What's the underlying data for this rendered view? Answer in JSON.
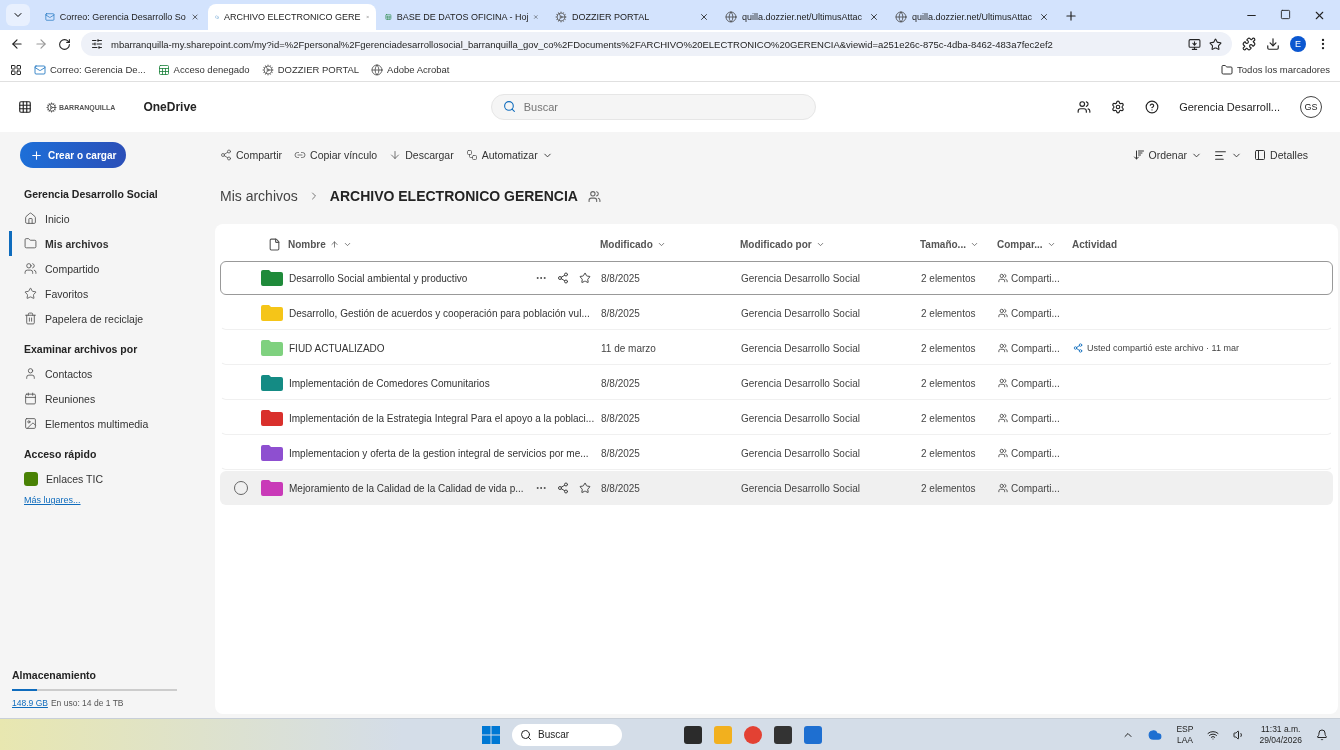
{
  "browser": {
    "tabs": [
      {
        "title": "Correo: Gerencia Desarrollo So",
        "selected": false
      },
      {
        "title": "ARCHIVO ELECTRONICO GERE",
        "selected": true
      },
      {
        "title": "BASE DE DATOS OFICINA - Hoj",
        "selected": false
      },
      {
        "title": "DOZZIER PORTAL",
        "selected": false
      },
      {
        "title": "quilla.dozzier.net/UltimusAttac",
        "selected": false
      },
      {
        "title": "quilla.dozzier.net/UltimusAttac",
        "selected": false
      }
    ],
    "address": "mbarranquilla-my.sharepoint.com/my?id=%2Fpersonal%2Fgerenciadesarrollosocial_barranquilla_gov_co%2FDocuments%2FARCHIVO%20ELECTRONICO%20GERENCIA&viewid=a251e26c-875c-4dba-8462-483a7fec2ef2",
    "profile": "E",
    "bookmarks": [
      "Correo: Gerencia De...",
      "Acceso denegado",
      "DOZZIER PORTAL",
      "Adobe Acrobat"
    ],
    "all_bookmarks": "Todos los marcadores"
  },
  "header": {
    "logo": "BARRANQUILLA",
    "app": "OneDrive",
    "search_placeholder": "Buscar",
    "user": "Gerencia Desarroll...",
    "initials": "GS"
  },
  "sidebar": {
    "create_button": "Crear o cargar",
    "account": "Gerencia Desarrollo Social",
    "items": [
      {
        "label": "Inicio",
        "selected": false
      },
      {
        "label": "Mis archivos",
        "selected": true
      },
      {
        "label": "Compartido",
        "selected": false
      },
      {
        "label": "Favoritos",
        "selected": false
      },
      {
        "label": "Papelera de reciclaje",
        "selected": false
      }
    ],
    "browse_heading": "Examinar archivos por",
    "browse_items": [
      "Contactos",
      "Reuniones",
      "Elementos multimedia"
    ],
    "quick_heading": "Acceso rápido",
    "quick_items": [
      {
        "label": "Enlaces TIC",
        "color": "#498205"
      }
    ],
    "more_link": "Más lugares...",
    "storage": {
      "heading": "Almacenamiento",
      "used_link": "148.9 GB",
      "text": "En uso: 14 de 1 TB",
      "level": 0.15
    }
  },
  "toolbar": {
    "actions": [
      "Compartir",
      "Copiar vínculo",
      "Descargar",
      "Automatizar"
    ],
    "sort": "Ordenar",
    "details": "Detalles"
  },
  "breadcrumb": {
    "parent": "Mis archivos",
    "current": "ARCHIVO ELECTRONICO GERENCIA"
  },
  "table": {
    "columns": [
      "Nombre",
      "Modificado",
      "Modificado por",
      "Tamaño...",
      "Compar...",
      "Actividad"
    ],
    "rows": [
      {
        "name": "Desarrollo Social ambiental y productivo",
        "modified": "8/8/2025",
        "by": "Gerencia Desarrollo Social",
        "size": "2 elementos",
        "sharing": "Comparti...",
        "color": "#1f8a3a",
        "focused": true,
        "hovered": false
      },
      {
        "name": "Desarrollo, Gestión de acuerdos y cooperación para población vul...",
        "modified": "8/8/2025",
        "by": "Gerencia Desarrollo Social",
        "size": "2 elementos",
        "sharing": "Comparti...",
        "color": "#f5c518",
        "focused": false,
        "hovered": false
      },
      {
        "name": "FIUD ACTUALIZADO",
        "modified": "11 de marzo",
        "by": "Gerencia Desarrollo Social",
        "size": "2 elementos",
        "sharing": "Comparti...",
        "activity": "Usted compartió este archivo · 11 mar",
        "color": "#7fd17f",
        "focused": false,
        "hovered": false
      },
      {
        "name": "Implementación de Comedores Comunitarios",
        "modified": "8/8/2025",
        "by": "Gerencia Desarrollo Social",
        "size": "2 elementos",
        "sharing": "Comparti...",
        "color": "#148b84",
        "focused": false,
        "hovered": false
      },
      {
        "name": "Implementación de la Estrategia Integral Para el apoyo a la poblaci...",
        "modified": "8/8/2025",
        "by": "Gerencia Desarrollo Social",
        "size": "2 elementos",
        "sharing": "Comparti...",
        "color": "#d9302c",
        "focused": false,
        "hovered": false
      },
      {
        "name": "Implementacion y oferta de la gestion integral de servicios por me...",
        "modified": "8/8/2025",
        "by": "Gerencia Desarrollo Social",
        "size": "2 elementos",
        "sharing": "Comparti...",
        "color": "#8e4fd0",
        "focused": false,
        "hovered": false
      },
      {
        "name": "Mejoramiento de la Calidad de la Calidad de vida p...",
        "modified": "8/8/2025",
        "by": "Gerencia Desarrollo Social",
        "size": "2 elementos",
        "sharing": "Comparti...",
        "color": "#c93ab8",
        "focused": false,
        "hovered": true
      }
    ]
  },
  "taskbar": {
    "search": "Buscar",
    "language": "ESP",
    "layout": "LAA",
    "time": "11:31 a.m.",
    "date": "29/04/2026"
  }
}
